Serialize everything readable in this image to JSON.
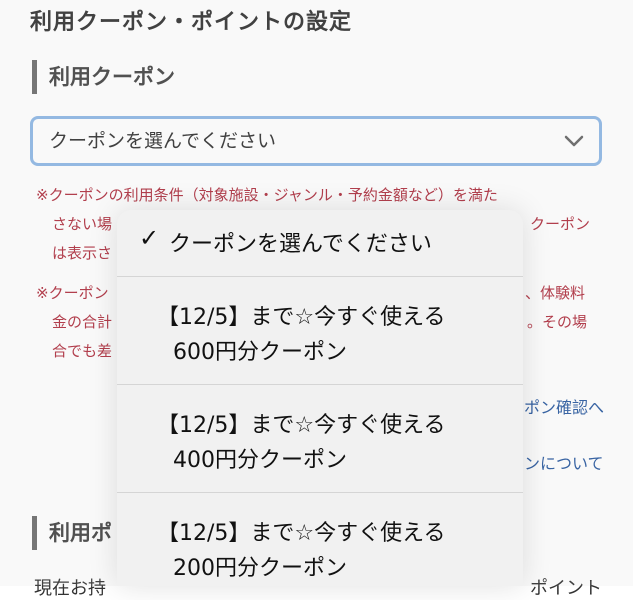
{
  "page_title": "利用クーポン・ポイントの設定",
  "sections": {
    "coupon_heading": "利用クーポン",
    "point_heading_partial": "利用ポ"
  },
  "coupon_select": {
    "selected_value": "クーポンを選んでください",
    "chevron_icon": "chevron-down-icon"
  },
  "notices": {
    "mark": "※",
    "notice1_line1": "クーポンの利用条件（対象施設・ジャンル・予約金額など）を満た",
    "notice1_line2_left": "さない場",
    "notice1_line2_right": "クーポン",
    "notice1_line3_left": "は表示さ",
    "notice2_line1_left": "クーポン",
    "notice2_line1_right": "、体験料",
    "notice2_line2_left": "金の合計",
    "notice2_line2_right": "。その場",
    "notice2_line3_left": "合でも差"
  },
  "links": {
    "coupon_check_partial": "ポン確認へ",
    "coupon_about_partial": "ンについて"
  },
  "bottom_partial": {
    "left": "現在お持",
    "right": "ポイント"
  },
  "dropdown": {
    "check_mark": "✓",
    "options": [
      {
        "line1": "クーポンを選んでください",
        "line2": "",
        "selected": true
      },
      {
        "line1": "【12/5】まで☆今すぐ使える",
        "line2": "600円分クーポン",
        "selected": false
      },
      {
        "line1": "【12/5】まで☆今すぐ使える",
        "line2": "400円分クーポン",
        "selected": false
      },
      {
        "line1": "【12/5】まで☆今すぐ使える",
        "line2": "200円分クーポン",
        "selected": false
      }
    ]
  },
  "colors": {
    "notice": "#b03040",
    "link": "#2a5aa0",
    "focus_border": "#8fb8e6"
  }
}
